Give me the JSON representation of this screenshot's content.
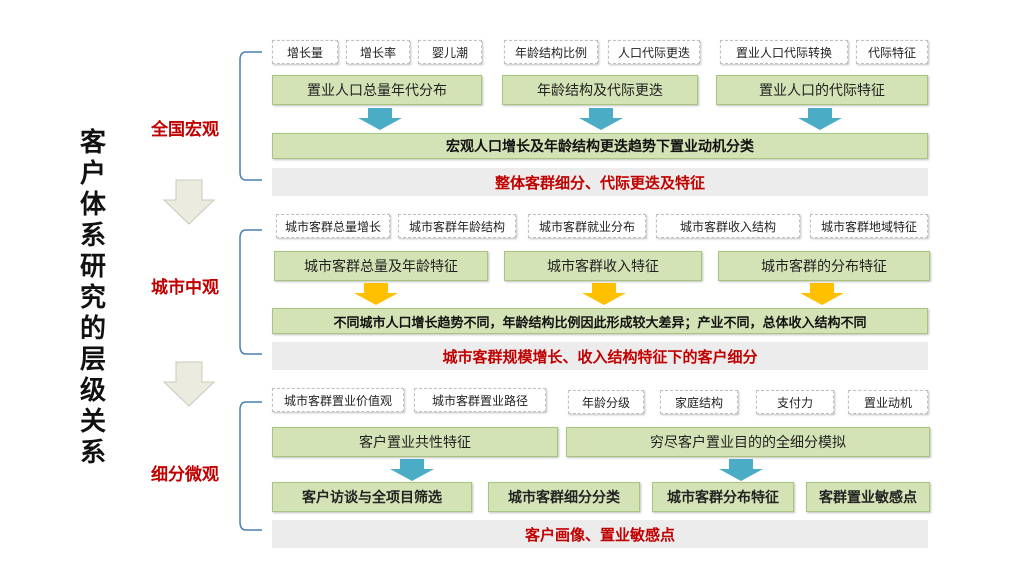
{
  "title": "客户体系研究的层级关系",
  "colors": {
    "blue_arrow": "#4bacc6",
    "yellow_arrow": "#ffc000",
    "box_fill": "#d4e3b5",
    "label_red": "#c00000"
  },
  "macro": {
    "label": "全国宏观",
    "tags": [
      "增长量",
      "增长率",
      "婴儿潮",
      "年龄结构比例",
      "人口代际更迭",
      "置业人口代际转换",
      "代际特征"
    ],
    "features": [
      "置业人口总量年代分布",
      "年龄结构及代际更迭",
      "置业人口的代际特征"
    ],
    "summary": "宏观人口增长及年龄结构更迭趋势下置业动机分类",
    "result": "整体客群细分、代际更迭及特征"
  },
  "city": {
    "label": "城市中观",
    "tags": [
      "城市客群总量增长",
      "城市客群年龄结构",
      "城市客群就业分布",
      "城市客群收入结构",
      "城市客群地域特征"
    ],
    "features": [
      "城市客群总量及年龄特征",
      "城市客群收入特征",
      "城市客群的分布特征"
    ],
    "summary": "不同城市人口增长趋势不同，年龄结构比例因此形成较大差异；产业不同，总体收入结构不同",
    "result": "城市客群规模增长、收入结构特征下的客户细分"
  },
  "micro": {
    "label": "细分微观",
    "tags": [
      "城市客群置业价值观",
      "城市客群置业路径",
      "年龄分级",
      "家庭结构",
      "支付力",
      "置业动机"
    ],
    "features": [
      "客户置业共性特征",
      "穷尽客户置业目的的全细分模拟"
    ],
    "outputs": [
      "客户访谈与全项目筛选",
      "城市客群细分分类",
      "城市客群分布特征",
      "客群置业敏感点"
    ],
    "result": "客户画像、置业敏感点"
  }
}
